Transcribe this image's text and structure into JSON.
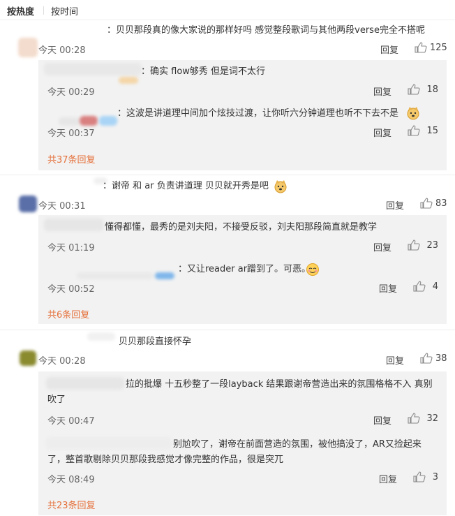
{
  "sort": {
    "hot": "按热度",
    "time": "按时间"
  },
  "labels": {
    "reply": "回复"
  },
  "comments": [
    {
      "text": "：贝贝那段真的像大家说的那样好吗 感觉整段歌词与其他两段verse完全不搭呢",
      "time": "今天 00:28",
      "likes": "125",
      "replies": [
        {
          "text": "：确实 flow够秀 但是词不太行",
          "time": "今天 00:29",
          "likes": "18"
        },
        {
          "text": "：这波是讲道理中间加个炫技过渡，让你听六分钟道理也听不下去不是",
          "time": "今天 00:37",
          "likes": "15"
        }
      ],
      "more": "共37条回复"
    },
    {
      "text": "：谢帝 和  ar 负责讲道理  贝贝就开秀是吧",
      "time": "今天 00:31",
      "likes": "83",
      "replies": [
        {
          "text": "懂得都懂，最秀的是刘夫阳，不接受反驳，刘夫阳那段简直就是教学",
          "time": "今天 01:19",
          "likes": "23"
        },
        {
          "text": "：又让reader ar蹭到了。可恶。",
          "time": "今天 00:52",
          "likes": "4"
        }
      ],
      "more": "共6条回复"
    },
    {
      "text": "贝贝那段直接怀孕",
      "time": "今天 00:28",
      "likes": "38",
      "replies": [
        {
          "text": "拉的批爆 十五秒整了一段layback 结果跟谢帝营造出来的氛围格格不入 真别吹了",
          "time": "今天 00:47",
          "likes": "32"
        },
        {
          "text": "别尬吹了，谢帝在前面营造的氛围，被他搞没了，AR又捡起来了，整首歌剔除贝贝那段我感觉才像完整的作品，很是突兀",
          "time": "今天 08:49",
          "likes": "3"
        }
      ],
      "more": "共23条回复"
    }
  ],
  "colors": {
    "more_link": "#e5703a",
    "reply_bg": "#f2f2f2"
  }
}
